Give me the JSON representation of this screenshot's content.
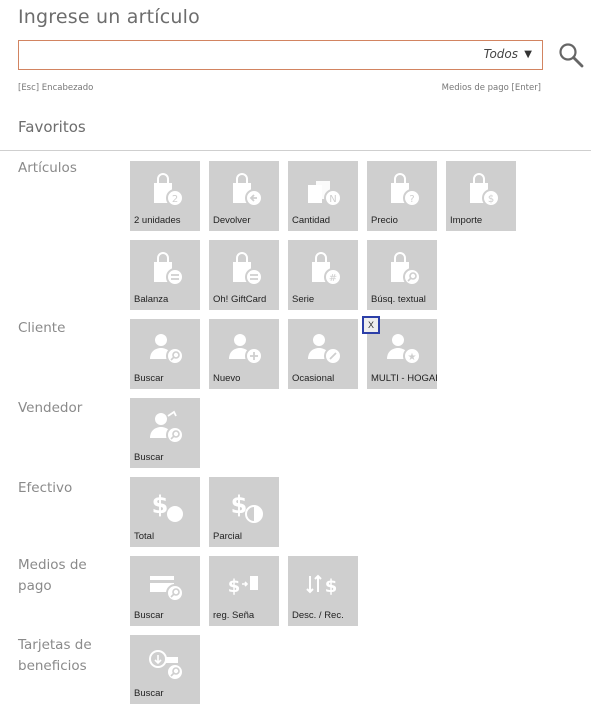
{
  "header": {
    "title": "Ingrese un artículo",
    "search_value": "",
    "filter_value": "Todos",
    "hint_left": "[Esc]  Encabezado",
    "hint_right": "Medios de pago  [Enter]"
  },
  "favorites": {
    "title": "Favoritos",
    "categories": [
      {
        "label": "Artículos",
        "tiles": [
          {
            "label": "2 unidades",
            "icon": "bag-number-icon"
          },
          {
            "label": "Devolver",
            "icon": "bag-return-icon"
          },
          {
            "label": "Cantidad",
            "icon": "bag-quantity-icon"
          },
          {
            "label": "Precio",
            "icon": "bag-price-icon"
          },
          {
            "label": "Importe",
            "icon": "bag-amount-icon"
          },
          {
            "label": "Balanza",
            "icon": "bag-scale-icon"
          },
          {
            "label": "Oh! GiftCard",
            "icon": "bag-giftcard-icon"
          },
          {
            "label": "Serie",
            "icon": "bag-serial-icon"
          },
          {
            "label": "Búsq. textual",
            "icon": "bag-text-search-icon"
          }
        ]
      },
      {
        "label": "Cliente",
        "tiles": [
          {
            "label": "Buscar",
            "icon": "user-search-icon"
          },
          {
            "label": "Nuevo",
            "icon": "user-add-icon"
          },
          {
            "label": "Ocasional",
            "icon": "user-occasional-icon"
          },
          {
            "label": "MULTI - HOGAR",
            "icon": "user-star-icon"
          }
        ]
      },
      {
        "label": "Vendedor",
        "tiles": [
          {
            "label": "Buscar",
            "icon": "seller-search-icon"
          }
        ]
      },
      {
        "label": "Efectivo",
        "tiles": [
          {
            "label": "Total",
            "icon": "cash-total-icon"
          },
          {
            "label": "Parcial",
            "icon": "cash-partial-icon"
          }
        ]
      },
      {
        "label": "Medios de pago",
        "tiles": [
          {
            "label": "Buscar",
            "icon": "card-search-icon"
          },
          {
            "label": "reg. Seña",
            "icon": "deposit-icon"
          },
          {
            "label": "Desc. / Rec.",
            "icon": "discount-icon"
          }
        ]
      },
      {
        "label": "Tarjetas de beneficios",
        "tiles": [
          {
            "label": "Buscar",
            "icon": "benefit-card-search-icon"
          }
        ]
      }
    ],
    "remove_label": "X"
  }
}
